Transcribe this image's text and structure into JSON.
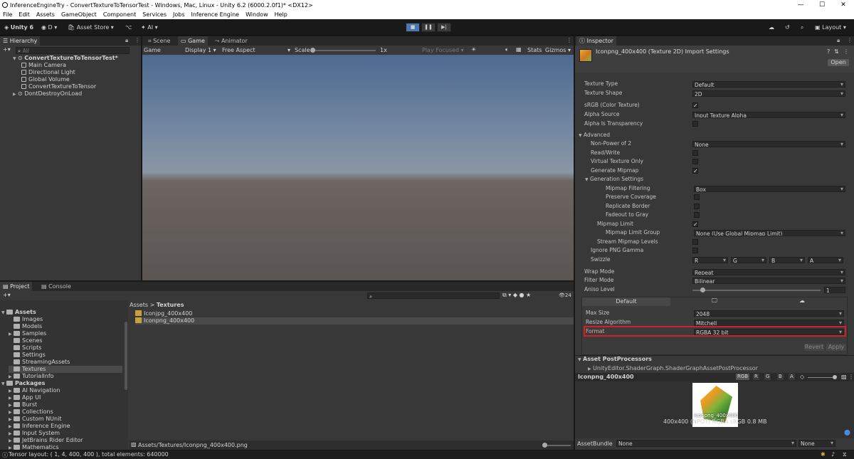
{
  "window": {
    "title": "InferenceEngineTry - ConvertTextureToTensorTest - Windows, Mac, Linux - Unity 6.2 (6000.2.0f1)* <DX12>",
    "minimize": "—",
    "maximize": "☐",
    "close": "✕"
  },
  "menu": [
    "File",
    "Edit",
    "Assets",
    "GameObject",
    "Component",
    "Services",
    "Jobs",
    "Inference Engine",
    "Window",
    "Help"
  ],
  "toolbar": {
    "unity": "Unity 6",
    "account": "D",
    "asset_store": "Asset Store",
    "ai": "AI",
    "layout": "Layout"
  },
  "hierarchy": {
    "tab": "Hierarchy",
    "search_placeholder": "All",
    "scene": "ConvertTextureToTensorTest*",
    "items": [
      "Main Camera",
      "Directional Light",
      "Global Volume",
      "ConvertTextureToTensor"
    ],
    "dont_destroy": "DontDestroyOnLoad"
  },
  "game": {
    "tabs": [
      "Scene",
      "Game",
      "Animator"
    ],
    "mode": "Game",
    "display": "Display 1",
    "aspect": "Free Aspect",
    "scale_label": "Scale",
    "scale_value": "1x",
    "play_focused": "Play Focused",
    "stats": "Stats",
    "gizmos": "Gizmos"
  },
  "project": {
    "tabs": [
      "Project",
      "Console"
    ],
    "breadcrumb": [
      "Assets",
      "Textures"
    ],
    "count": "24",
    "tree": [
      {
        "label": "Assets",
        "level": 0,
        "arrow": "▼",
        "bold": true
      },
      {
        "label": "Images",
        "level": 1,
        "arrow": ""
      },
      {
        "label": "Models",
        "level": 1,
        "arrow": ""
      },
      {
        "label": "Samples",
        "level": 1,
        "arrow": "▶"
      },
      {
        "label": "Scenes",
        "level": 1,
        "arrow": ""
      },
      {
        "label": "Scripts",
        "level": 1,
        "arrow": ""
      },
      {
        "label": "Settings",
        "level": 1,
        "arrow": ""
      },
      {
        "label": "StreamingAssets",
        "level": 1,
        "arrow": ""
      },
      {
        "label": "Textures",
        "level": 1,
        "arrow": "",
        "selected": true
      },
      {
        "label": "TutorialInfo",
        "level": 1,
        "arrow": "▶"
      },
      {
        "label": "Packages",
        "level": 0,
        "arrow": "▼",
        "bold": true
      },
      {
        "label": "AI Navigation",
        "level": 1,
        "arrow": "▶"
      },
      {
        "label": "App UI",
        "level": 1,
        "arrow": "▶"
      },
      {
        "label": "Burst",
        "level": 1,
        "arrow": "▶"
      },
      {
        "label": "Collections",
        "level": 1,
        "arrow": "▶"
      },
      {
        "label": "Custom NUnit",
        "level": 1,
        "arrow": "▶"
      },
      {
        "label": "Inference Engine",
        "level": 1,
        "arrow": "▶"
      },
      {
        "label": "Input System",
        "level": 1,
        "arrow": "▶"
      },
      {
        "label": "JetBrains Rider Editor",
        "level": 1,
        "arrow": "▶"
      },
      {
        "label": "Mathematics",
        "level": 1,
        "arrow": "▶"
      }
    ],
    "files": [
      "Iconjpg_400x400",
      "Iconpng_400x400"
    ],
    "path": "Assets/Textures/Iconpng_400x400.png"
  },
  "status": "Tensor layout: ( 1, 4, 400, 400 ), total elements: 640000",
  "inspector": {
    "tab": "Inspector",
    "title": "Iconpng_400x400 (Texture 2D) Import Settings",
    "open": "Open",
    "rows": [
      {
        "label": "Texture Type",
        "value": "Default",
        "kind": "dd",
        "indent": 0
      },
      {
        "label": "Texture Shape",
        "value": "2D",
        "kind": "dd",
        "indent": 0
      },
      {
        "label": "sRGB (Color Texture)",
        "kind": "chk",
        "checked": true,
        "indent": 0
      },
      {
        "label": "Alpha Source",
        "value": "Input Texture Alpha",
        "kind": "dd",
        "indent": 0
      },
      {
        "label": "Alpha Is Transparency",
        "kind": "chk",
        "checked": false,
        "indent": 0
      },
      {
        "label": "Advanced",
        "kind": "fold",
        "indent": 0
      },
      {
        "label": "Non-Power of 2",
        "value": "None",
        "kind": "dd",
        "indent": 1
      },
      {
        "label": "Read/Write",
        "kind": "chk",
        "checked": false,
        "indent": 1
      },
      {
        "label": "Virtual Texture Only",
        "kind": "chk",
        "checked": false,
        "indent": 1
      },
      {
        "label": "Generate Mipmap",
        "kind": "chk",
        "checked": true,
        "indent": 1
      },
      {
        "label": "Generation Settings",
        "kind": "fold",
        "indent": 1
      },
      {
        "label": "Mipmap Filtering",
        "value": "Box",
        "kind": "dd",
        "indent": 3
      },
      {
        "label": "Preserve Coverage",
        "kind": "chk",
        "checked": false,
        "indent": 3
      },
      {
        "label": "Replicate Border",
        "kind": "chk",
        "checked": false,
        "indent": 3
      },
      {
        "label": "Fadeout to Gray",
        "kind": "chk",
        "checked": false,
        "indent": 3
      },
      {
        "label": "Mipmap Limit",
        "kind": "chk",
        "checked": true,
        "indent": 2
      },
      {
        "label": "Mipmap Limit Group",
        "value": "None (Use Global Mipmap Limit)",
        "kind": "dd",
        "indent": 3
      },
      {
        "label": "Stream Mipmap Levels",
        "kind": "chk",
        "checked": false,
        "indent": 2
      },
      {
        "label": "Ignore PNG Gamma",
        "kind": "chk",
        "checked": false,
        "indent": 1
      },
      {
        "label": "Swizzle",
        "kind": "swizzle",
        "values": [
          "R",
          "G",
          "B",
          "A"
        ],
        "indent": 1
      },
      {
        "label": "Wrap Mode",
        "value": "Repeat",
        "kind": "dd",
        "indent": 0
      },
      {
        "label": "Filter Mode",
        "value": "Bilinear",
        "kind": "dd",
        "indent": 0
      },
      {
        "label": "Aniso Level",
        "value": "1",
        "kind": "slider",
        "indent": 0
      }
    ],
    "platform_tab": "Default",
    "platform": [
      {
        "label": "Max Size",
        "value": "2048"
      },
      {
        "label": "Resize Algorithm",
        "value": "Mitchell"
      },
      {
        "label": "Format",
        "value": "RGBA 32 bit",
        "highlight": true
      }
    ],
    "revert": "Revert",
    "apply": "Apply",
    "postprocessors": "Asset PostProcessors",
    "postprocessor_item": "UnityEditor.ShaderGraph.ShaderGraphAssetPostProcessor",
    "preview": {
      "name": "Iconpng_400x400",
      "channels": [
        "RGB",
        "R",
        "G",
        "B",
        "A"
      ],
      "info": "400x400 (NPOT) RGBA sRGB  0.8 MB",
      "overlay": "Iconpng_400x400"
    },
    "assetbundle": {
      "label": "AssetBundle",
      "value": "None",
      "variant": "None"
    }
  },
  "colors": {
    "highlight": "#d0202a",
    "accent": "#3d6fa8"
  }
}
